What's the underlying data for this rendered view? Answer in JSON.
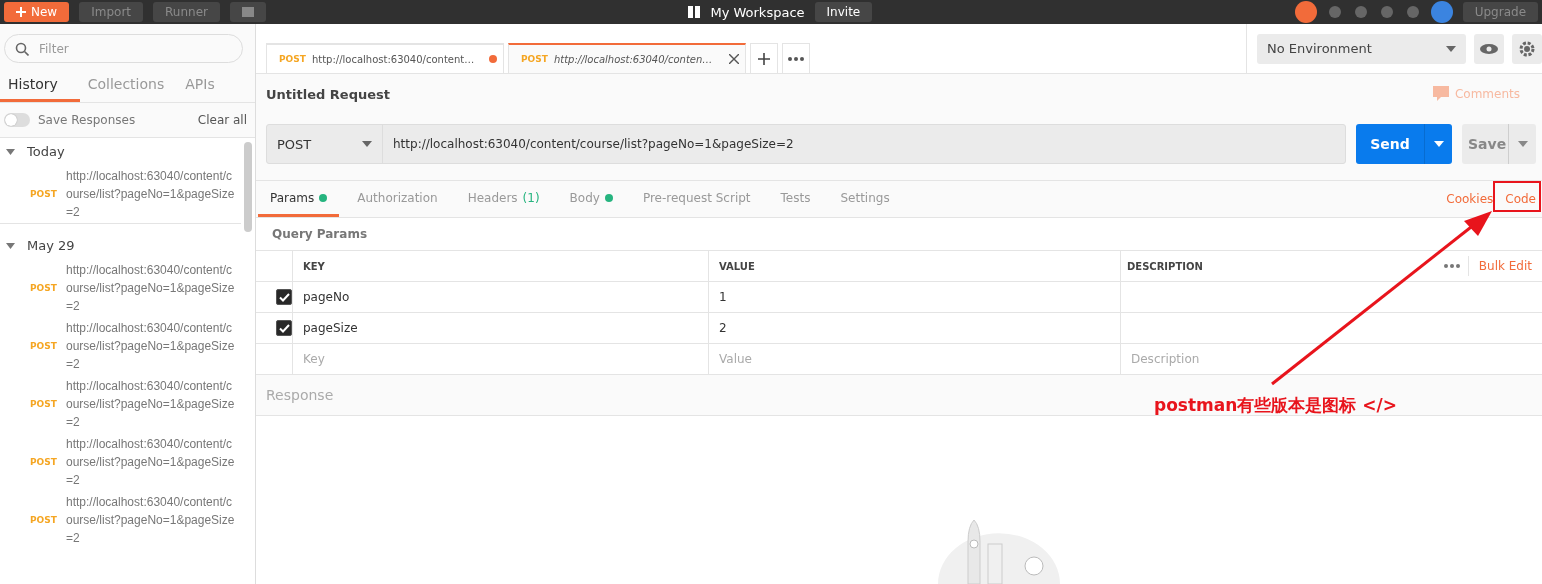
{
  "top_bar": {
    "new_button": "New",
    "buttons": [
      "Import",
      "Runner"
    ],
    "workspace": "My Workspace",
    "invite": "Invite",
    "upgrade": "Upgrade"
  },
  "sidebar": {
    "filter": {
      "placeholder": "Filter"
    },
    "tabs": [
      {
        "label": "History",
        "selected": true
      },
      {
        "label": "Collections",
        "selected": false
      },
      {
        "label": "APIs",
        "selected": false
      }
    ],
    "save_responses": {
      "label": "Save Responses",
      "on": false
    },
    "clear_all": "Clear all",
    "groups": [
      {
        "label": "Today",
        "expanded": true,
        "items": [
          {
            "method": "POST",
            "url": "http://localhost:63040/content/course/list?pageNo=1&pageSize=2"
          }
        ]
      },
      {
        "label": "May 29",
        "expanded": true,
        "items": [
          {
            "method": "POST",
            "url": "http://localhost:63040/content/course/list?pageNo=1&pageSize=2"
          },
          {
            "method": "POST",
            "url": "http://localhost:63040/content/course/list?pageNo=1&pageSize=2"
          },
          {
            "method": "POST",
            "url": "http://localhost:63040/content/course/list?pageNo=1&pageSize=2"
          },
          {
            "method": "POST",
            "url": "http://localhost:63040/content/course/list?pageNo=1&pageSize=2"
          },
          {
            "method": "POST",
            "url": "http://localhost:63040/content/course/list?pageNo=1&pageSize=2"
          }
        ]
      }
    ]
  },
  "request_tabs": [
    {
      "method": "POST",
      "url": "http://localhost:63040/content…",
      "unsaved": true,
      "selected": false
    },
    {
      "method": "POST",
      "url": "http://localhost:63040/conten…",
      "unsaved": false,
      "selected": true
    }
  ],
  "environment": "No Environment",
  "request": {
    "title": "Untitled Request",
    "comments": "Comments",
    "method": "POST",
    "url": "http://localhost:63040/content/course/list?pageNo=1&pageSize=2",
    "send": "Send",
    "save": "Save"
  },
  "option_tabs": [
    {
      "label": "Params",
      "dot": true,
      "selected": true
    },
    {
      "label": "Authorization",
      "dot": false,
      "selected": false
    },
    {
      "label": "Headers",
      "count": "(1)",
      "dot": false,
      "selected": false
    },
    {
      "label": "Body",
      "dot": true,
      "selected": false
    },
    {
      "label": "Pre-request Script",
      "dot": false,
      "selected": false
    },
    {
      "label": "Tests",
      "dot": false,
      "selected": false
    },
    {
      "label": "Settings",
      "dot": false,
      "selected": false
    }
  ],
  "links": [
    "Cookies",
    "Code"
  ],
  "params": {
    "title": "Query Params",
    "columns": [
      "KEY",
      "VALUE",
      "DESCRIPTION"
    ],
    "bulk_edit": "Bulk Edit",
    "rows": [
      {
        "key": "pageNo",
        "value": "1",
        "checked": true
      },
      {
        "key": "pageSize",
        "value": "2",
        "checked": true
      }
    ],
    "placeholders": {
      "key": "Key",
      "value": "Value",
      "description": "Description"
    }
  },
  "response": "Response",
  "annotation": {
    "text": "postman有些版本是图标 </>"
  }
}
